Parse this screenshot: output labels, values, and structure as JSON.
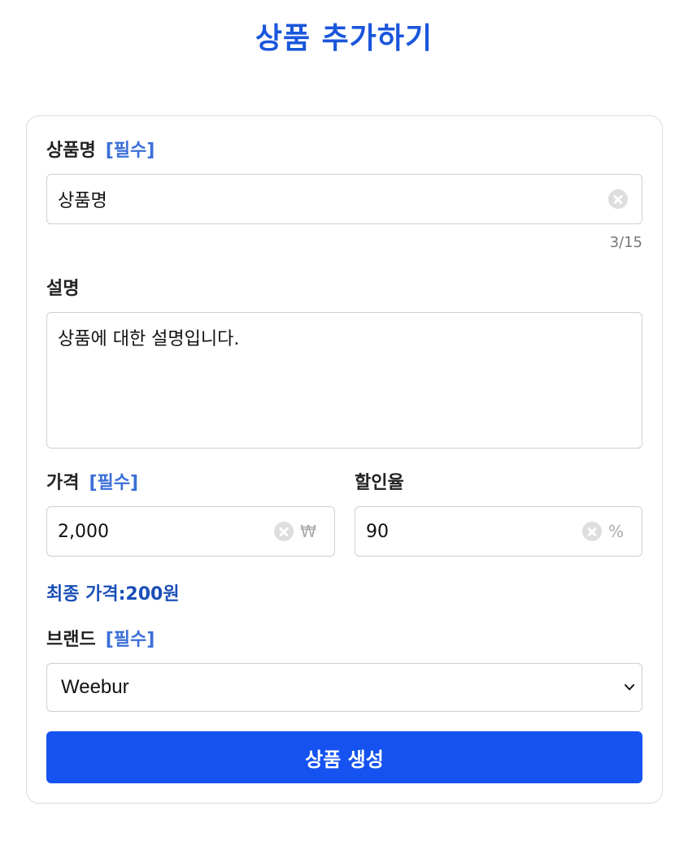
{
  "page": {
    "title": "상품 추가하기"
  },
  "form": {
    "name": {
      "label": "상품명",
      "required": "[필수]",
      "value": "상품명",
      "counter": "3/15"
    },
    "description": {
      "label": "설명",
      "value": "상품에 대한 설명입니다."
    },
    "price": {
      "label": "가격",
      "required": "[필수]",
      "value": "2,000",
      "unit": "₩"
    },
    "discount": {
      "label": "할인율",
      "value": "90",
      "unit": "%"
    },
    "final_price": "최종 가격:200원",
    "brand": {
      "label": "브랜드",
      "required": "[필수]",
      "selected": "Weebur"
    },
    "submit_label": "상품 생성"
  },
  "colors": {
    "accent": "#1a56db",
    "button": "#1552f0",
    "required": "#3b6fd9",
    "final_price": "#1a4fb8"
  },
  "icons": {
    "clear": "clear-circle-x-icon",
    "select": "chevron-down-icon"
  }
}
